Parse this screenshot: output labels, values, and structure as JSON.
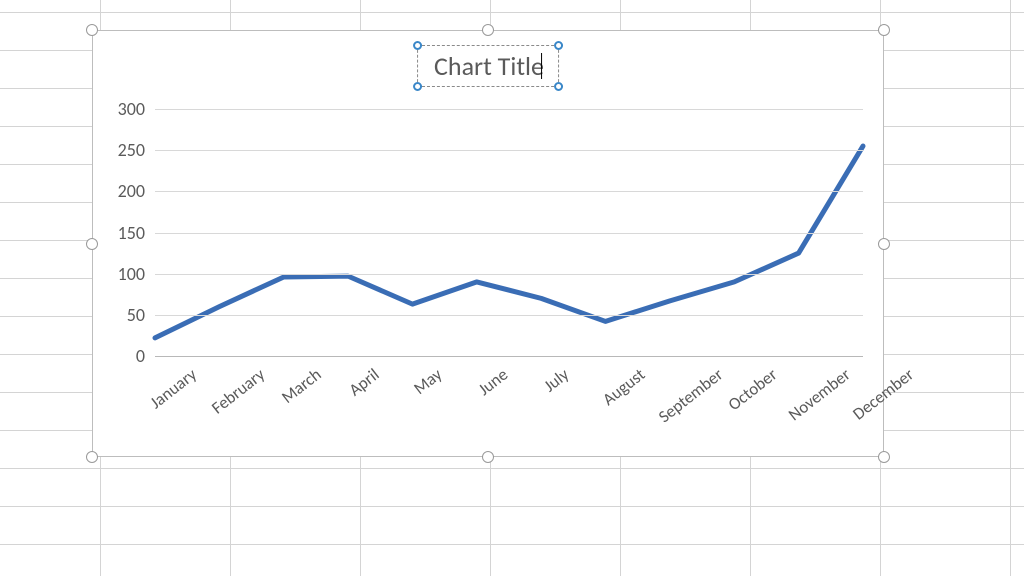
{
  "chart_data": {
    "type": "line",
    "title": "Chart Title",
    "categories": [
      "January",
      "February",
      "March",
      "April",
      "May",
      "June",
      "July",
      "August",
      "September",
      "October",
      "November",
      "December"
    ],
    "values": [
      22,
      60,
      96,
      97,
      63,
      90,
      70,
      42,
      67,
      90,
      125,
      255
    ],
    "ylim": [
      0,
      300
    ],
    "yticks": [
      0,
      50,
      100,
      150,
      200,
      250,
      300
    ],
    "line_color": "#3a6db5"
  }
}
